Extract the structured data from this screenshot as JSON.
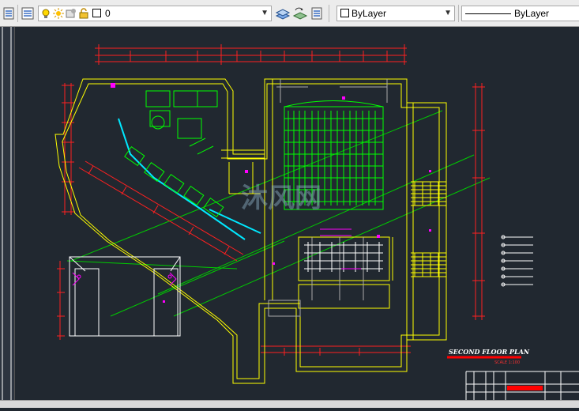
{
  "toolbar": {
    "layer_name": "0",
    "color_value": "ByLayer",
    "linetype_value": "ByLayer"
  },
  "drawing": {
    "title": "SECOND FLOOR PLAN",
    "scale": "SCALE 1:100",
    "watermark": "沐风网",
    "colors": {
      "background": "#212830",
      "wall": "#ffff00",
      "dimension": "#ff0000",
      "seat": "#00ff00",
      "curtain_wall": "#00ffff",
      "text": "#ffffff",
      "accent": "#ff00ff"
    }
  }
}
